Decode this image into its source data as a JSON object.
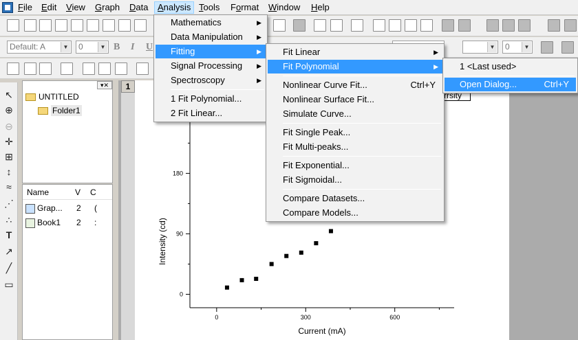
{
  "menubar": {
    "items": [
      {
        "label": "File",
        "u": "F"
      },
      {
        "label": "Edit",
        "u": "E"
      },
      {
        "label": "View",
        "u": "V"
      },
      {
        "label": "Graph",
        "u": "G"
      },
      {
        "label": "Data",
        "u": "D"
      },
      {
        "label": "Analysis",
        "u": "A"
      },
      {
        "label": "Tools",
        "u": "T"
      },
      {
        "label": "Format",
        "u": "o"
      },
      {
        "label": "Window",
        "u": "W"
      },
      {
        "label": "Help",
        "u": "H"
      }
    ]
  },
  "toolbar": {
    "font_combo": "Default: A",
    "size_combo": "0",
    "line_combo": "0",
    "bold": "B",
    "italic": "I",
    "underline": "U"
  },
  "project": {
    "root": "UNTITLED",
    "folder": "Folder1",
    "columns": [
      "Name",
      "V",
      "C"
    ],
    "items": [
      {
        "name": "Grap...",
        "v": "2",
        "c": "("
      },
      {
        "name": "Book1",
        "v": "2",
        "c": ":"
      }
    ]
  },
  "graph": {
    "window_number": "1",
    "legend_text": "rrsity"
  },
  "analysis_menu": {
    "items": [
      "Mathematics",
      "Data Manipulation",
      "Fitting",
      "Signal Processing",
      "Spectroscopy",
      "1 Fit Polynomial...",
      "2 Fit Linear..."
    ]
  },
  "fitting_menu": {
    "items": [
      "Fit Linear",
      "Fit Polynomial",
      "Nonlinear Curve Fit...",
      "Nonlinear Surface Fit...",
      "Simulate Curve...",
      "Fit Single Peak...",
      "Fit Multi-peaks...",
      "Fit Exponential...",
      "Fit Sigmoidal...",
      "Compare Datasets...",
      "Compare Models..."
    ],
    "nonlinear_shortcut": "Ctrl+Y"
  },
  "polynomial_menu": {
    "items": [
      "1 <Last used>",
      "Open Dialog..."
    ],
    "open_shortcut": "Ctrl+Y"
  },
  "chart_data": {
    "type": "scatter",
    "title": "",
    "xlabel": "Current (mA)",
    "ylabel": "Intensity (cd)",
    "xlim": [
      -90,
      800
    ],
    "ylim": [
      -20,
      300
    ],
    "xticks": [
      0,
      300,
      600
    ],
    "yticks": [
      0,
      90,
      180
    ],
    "series": [
      {
        "x": [
          35,
          85,
          133,
          185,
          235,
          285,
          335,
          385
        ],
        "y": [
          10,
          21,
          23,
          45,
          57,
          62,
          76,
          94
        ]
      }
    ],
    "marker_color": "#000000"
  }
}
